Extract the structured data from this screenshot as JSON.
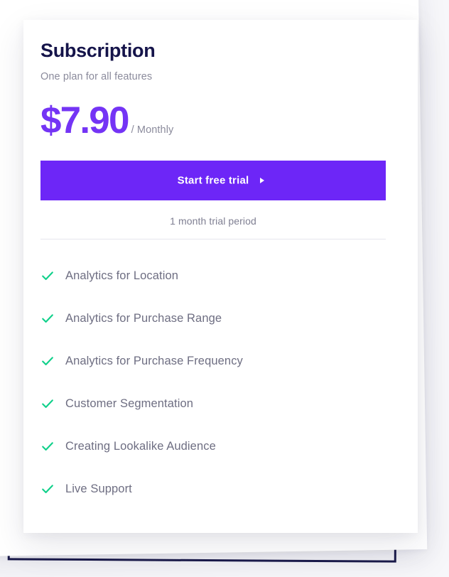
{
  "card": {
    "title": "Subscription",
    "subtitle": "One plan for all features",
    "price": {
      "amount": "$7.90",
      "period": "/ Monthly"
    },
    "cta": {
      "label": "Start free trial",
      "arrow_icon": "play-triangle-icon"
    },
    "trial_note": "1 month trial period",
    "features": [
      {
        "label": "Analytics for Location",
        "icon": "check-icon"
      },
      {
        "label": "Analytics for Purchase Range",
        "icon": "check-icon"
      },
      {
        "label": "Analytics for Purchase Frequency",
        "icon": "check-icon"
      },
      {
        "label": "Customer Segmentation",
        "icon": "check-icon"
      },
      {
        "label": "Creating Lookalike Audience",
        "icon": "check-icon"
      },
      {
        "label": "Live Support",
        "icon": "check-icon"
      }
    ]
  },
  "colors": {
    "accent_purple": "#6d26f7",
    "price_purple": "#7434f5",
    "check_green": "#0fd08a",
    "title_navy": "#15144a",
    "frame_navy": "#1b1b4b",
    "muted_text": "#8b8b9c",
    "feature_text": "#6e6e82",
    "divider": "#e6e6ee",
    "background": "#f7f7fa",
    "card_background": "#ffffff"
  }
}
